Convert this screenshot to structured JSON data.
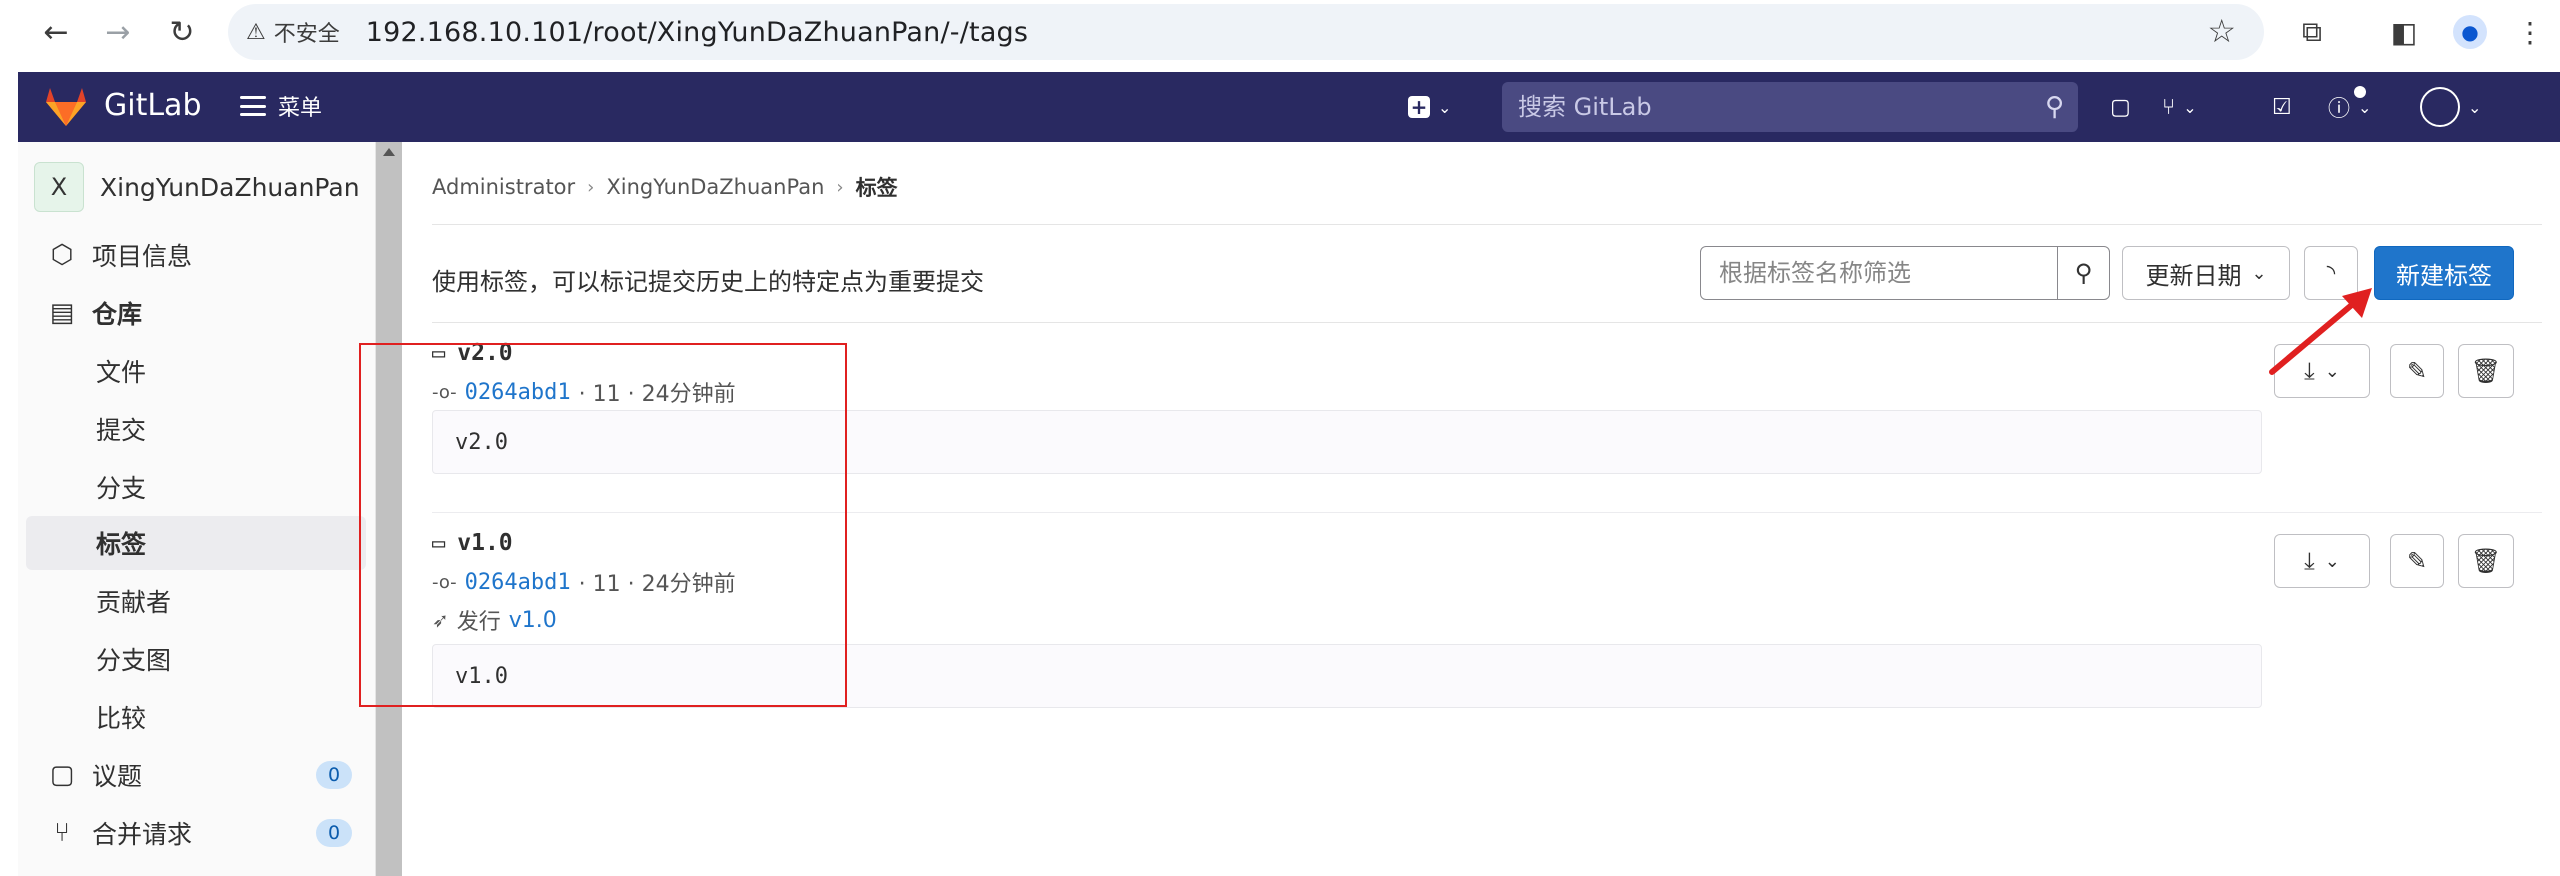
{
  "browser": {
    "security_label": "不安全",
    "url": "192.168.10.101/root/XingYunDaZhuanPan/-/tags"
  },
  "header": {
    "brand": "GitLab",
    "menu_label": "菜单",
    "search_placeholder": "搜索 GitLab"
  },
  "sidebar": {
    "project_initial": "X",
    "project_name": "XingYunDaZhuanPan",
    "items": [
      {
        "label": "项目信息",
        "icon": "info-icon"
      },
      {
        "label": "仓库",
        "icon": "document-icon"
      },
      {
        "label": "文件"
      },
      {
        "label": "提交"
      },
      {
        "label": "分支"
      },
      {
        "label": "标签"
      },
      {
        "label": "贡献者"
      },
      {
        "label": "分支图"
      },
      {
        "label": "比较"
      },
      {
        "label": "议题",
        "icon": "issues-icon",
        "count": "0"
      },
      {
        "label": "合并请求",
        "icon": "merge-request-icon",
        "count": "0"
      }
    ]
  },
  "breadcrumb": {
    "items": [
      "Administrator",
      "XingYunDaZhuanPan",
      "标签"
    ]
  },
  "toolbar": {
    "intro": "使用标签，可以标记提交历史上的特定点为重要提交",
    "filter_placeholder": "根据标签名称筛选",
    "sort_label": "更新日期",
    "new_tag_label": "新建标签"
  },
  "tags": [
    {
      "name": "v2.0",
      "commit_sha": "0264abd1",
      "commit_meta": "· 11 · 24分钟前",
      "message": "v2.0"
    },
    {
      "name": "v1.0",
      "commit_sha": "0264abd1",
      "commit_meta": "· 11 · 24分钟前",
      "release_label": "发行",
      "release_link": "v1.0",
      "message": "v1.0"
    }
  ],
  "colors": {
    "header_bg": "#292961",
    "primary": "#1f75cb",
    "annotation": "#e02020"
  }
}
